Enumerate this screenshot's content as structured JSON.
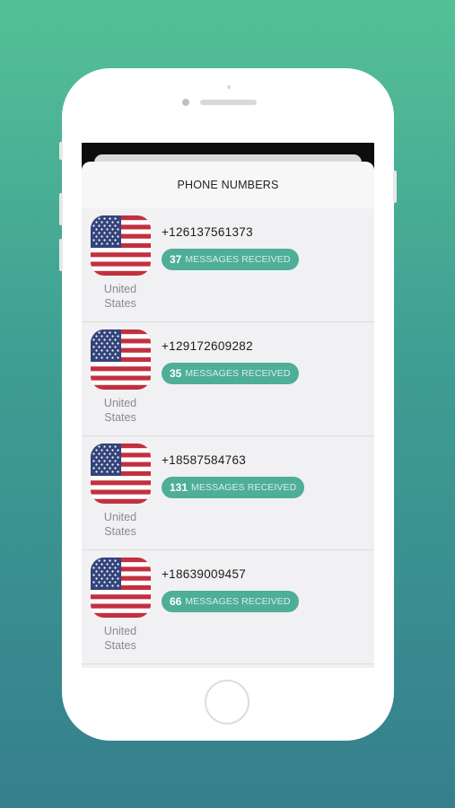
{
  "header": {
    "title": "PHONE NUMBERS"
  },
  "colors": {
    "badge": "#4fae98",
    "flag_red": "#c2303f",
    "flag_blue": "#33447c"
  },
  "numbers": [
    {
      "country": "United States",
      "flag_icon": "us-flag-icon",
      "phone": "+126137561373",
      "count": "37",
      "label": "MESSAGES RECEIVED"
    },
    {
      "country": "United States",
      "flag_icon": "us-flag-icon",
      "phone": "+129172609282",
      "count": "35",
      "label": "MESSAGES RECEIVED"
    },
    {
      "country": "United States",
      "flag_icon": "us-flag-icon",
      "phone": "+18587584763",
      "count": "131",
      "label": "MESSAGES RECEIVED"
    },
    {
      "country": "United States",
      "flag_icon": "us-flag-icon",
      "phone": "+18639009457",
      "count": "66",
      "label": "MESSAGES RECEIVED"
    }
  ]
}
